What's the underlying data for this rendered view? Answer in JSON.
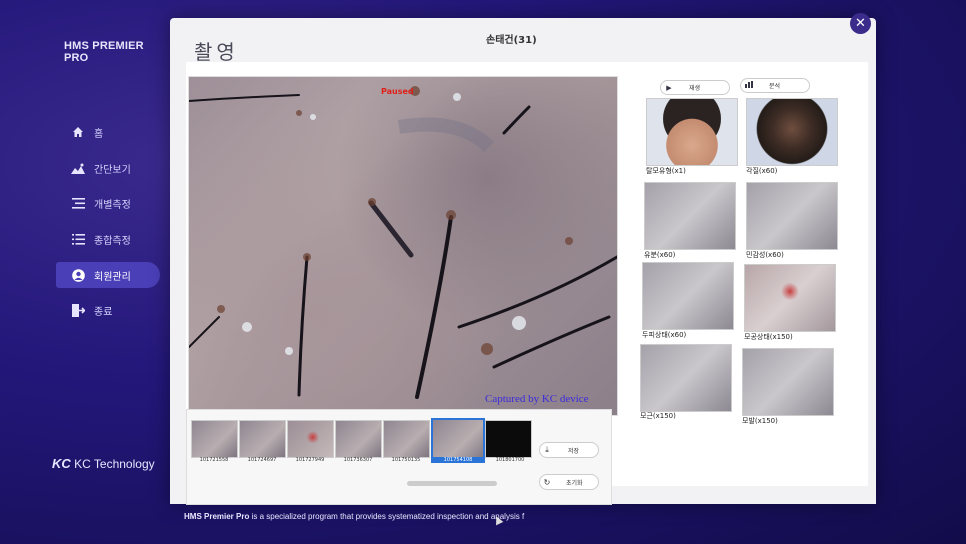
{
  "app": {
    "brand": "HMS PREMIER PRO",
    "company": "KC Technology",
    "company_mark": "KC"
  },
  "sidebar": {
    "items": [
      {
        "label": "홈",
        "icon": "home-icon"
      },
      {
        "label": "간단보기",
        "icon": "image-icon"
      },
      {
        "label": "개별측정",
        "icon": "list-icon"
      },
      {
        "label": "종합측정",
        "icon": "grid-list-icon"
      },
      {
        "label": "회원관리",
        "icon": "user-icon",
        "active": true
      },
      {
        "label": "종료",
        "icon": "exit-icon"
      }
    ]
  },
  "header": {
    "title": "촬영",
    "patient": "손태건(31)"
  },
  "viewer": {
    "status": "Paused",
    "watermark": "Captured by KC device"
  },
  "controls": {
    "play_label": "재생",
    "analyze_label": "분석"
  },
  "gallery": [
    {
      "label": "탈모유형(x1)"
    },
    {
      "label": "각질(x60)"
    },
    {
      "label": "유분(x60)"
    },
    {
      "label": "민감성(x60)"
    },
    {
      "label": "두피상태(x60)"
    },
    {
      "label": "모공상태(x150)"
    },
    {
      "label": "모근(x150)"
    },
    {
      "label": "모발(x150)"
    }
  ],
  "thumbnails": [
    {
      "label": "101721558"
    },
    {
      "label": "101724697"
    },
    {
      "label": "101727949"
    },
    {
      "label": "101736307"
    },
    {
      "label": "101750135"
    },
    {
      "label": "101754108",
      "selected": true
    },
    {
      "label": "101801700"
    }
  ],
  "strip_buttons": {
    "save_label": "저장",
    "reset_label": "초기화"
  },
  "tagline": {
    "bold": "HMS Premier Pro",
    "rest": " is a specialized program that provides systematized inspection and analysis f"
  },
  "colors": {
    "accent": "#3b2c8c",
    "active_nav": "#4b3fb8",
    "paused": "#e0201a",
    "watermark": "#3a2bdc",
    "selection": "#2a74d8"
  }
}
